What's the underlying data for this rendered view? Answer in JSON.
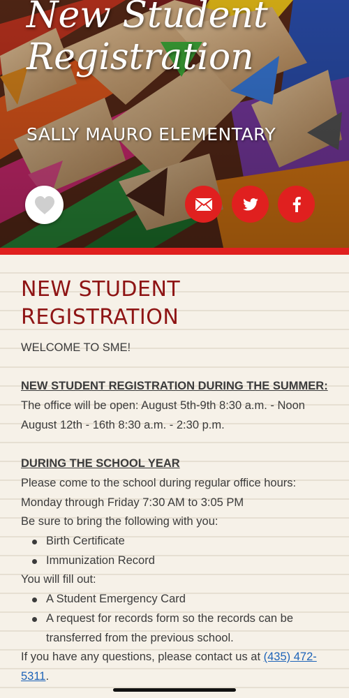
{
  "hero": {
    "title_line1": "New Student",
    "title_line2": "Registration",
    "school": "SALLY MAURO ELEMENTARY"
  },
  "icons": {
    "like": "heart-icon",
    "email": "envelope-icon",
    "twitter": "twitter-bird-icon",
    "facebook": "facebook-f-icon"
  },
  "colors": {
    "accent_red": "#e0201f",
    "heading_red": "#8e1414",
    "link_blue": "#1d63b8",
    "body_text": "#3b3b3b"
  },
  "content": {
    "heading": "NEW STUDENT REGISTRATION",
    "welcome": "WELCOME TO SME!",
    "summer_heading": "NEW STUDENT REGISTRATION DURING THE SUMMER:",
    "summer_line1": "The office will be open: August 5th-9th 8:30 a.m. - Noon",
    "summer_line2": "August 12th - 16th 8:30 a.m. - 2:30 p.m.",
    "year_heading": "DURING THE SCHOOL YEAR",
    "year_line1": "Please come to the school during regular office hours:",
    "year_line2": "Monday through Friday 7:30 AM to 3:05 PM",
    "bring_intro": "Be sure to bring the following with you:",
    "bring_items": [
      "Birth Certificate",
      "Immunization Record"
    ],
    "fill_intro": "You will fill out:",
    "fill_items": [
      "A Student Emergency Card",
      "A request for records form so the records can be transferred from the previous school."
    ],
    "contact_text": "If you have any questions, please contact us at ",
    "contact_phone": "(435) 472-5311",
    "contact_end": "."
  }
}
